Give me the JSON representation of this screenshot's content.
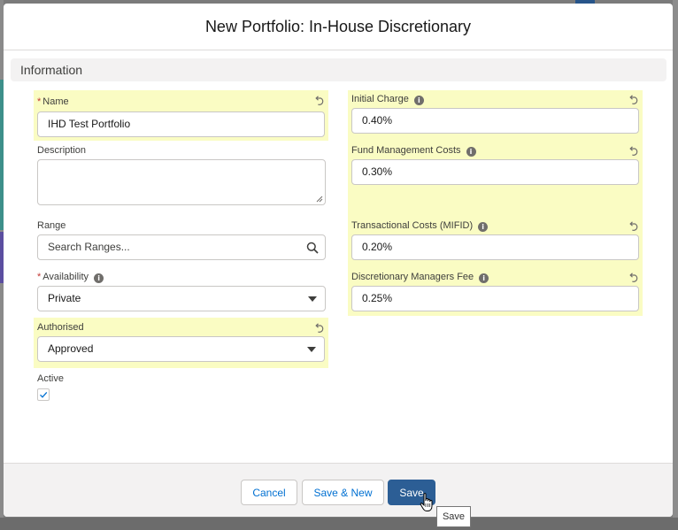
{
  "modal": {
    "title": "New Portfolio: In-House Discretionary",
    "section_title": "Information"
  },
  "left_fields": {
    "name": {
      "label": "Name",
      "required_mark": "*",
      "value": "IHD Test Portfolio"
    },
    "description": {
      "label": "Description",
      "value": ""
    },
    "range": {
      "label": "Range",
      "placeholder": "Search Ranges..."
    },
    "availability": {
      "label": "Availability",
      "required_mark": "*",
      "value": "Private"
    },
    "authorised": {
      "label": "Authorised",
      "value": "Approved"
    },
    "active": {
      "label": "Active",
      "checked": true
    }
  },
  "right_fields": {
    "initial_charge": {
      "label": "Initial Charge",
      "value": "0.40%"
    },
    "fund_management_costs": {
      "label": "Fund Management Costs",
      "value": "0.30%"
    },
    "transactional_costs": {
      "label": "Transactional Costs (MIFID)",
      "value": "0.20%"
    },
    "discretionary_managers_fee": {
      "label": "Discretionary Managers Fee",
      "value": "0.25%"
    }
  },
  "footer": {
    "cancel_label": "Cancel",
    "save_new_label": "Save & New",
    "save_label": "Save",
    "tooltip": "Save"
  },
  "icons": {
    "info": "info-icon",
    "undo": "undo-icon",
    "search": "search-icon",
    "dropdown": "chevron-down-icon",
    "check": "check-icon",
    "cursor": "hand-pointer-icon"
  },
  "colors": {
    "highlight": "#fafcc3",
    "brand": "#2c5e95",
    "link": "#0070d2",
    "required": "#c23934"
  }
}
